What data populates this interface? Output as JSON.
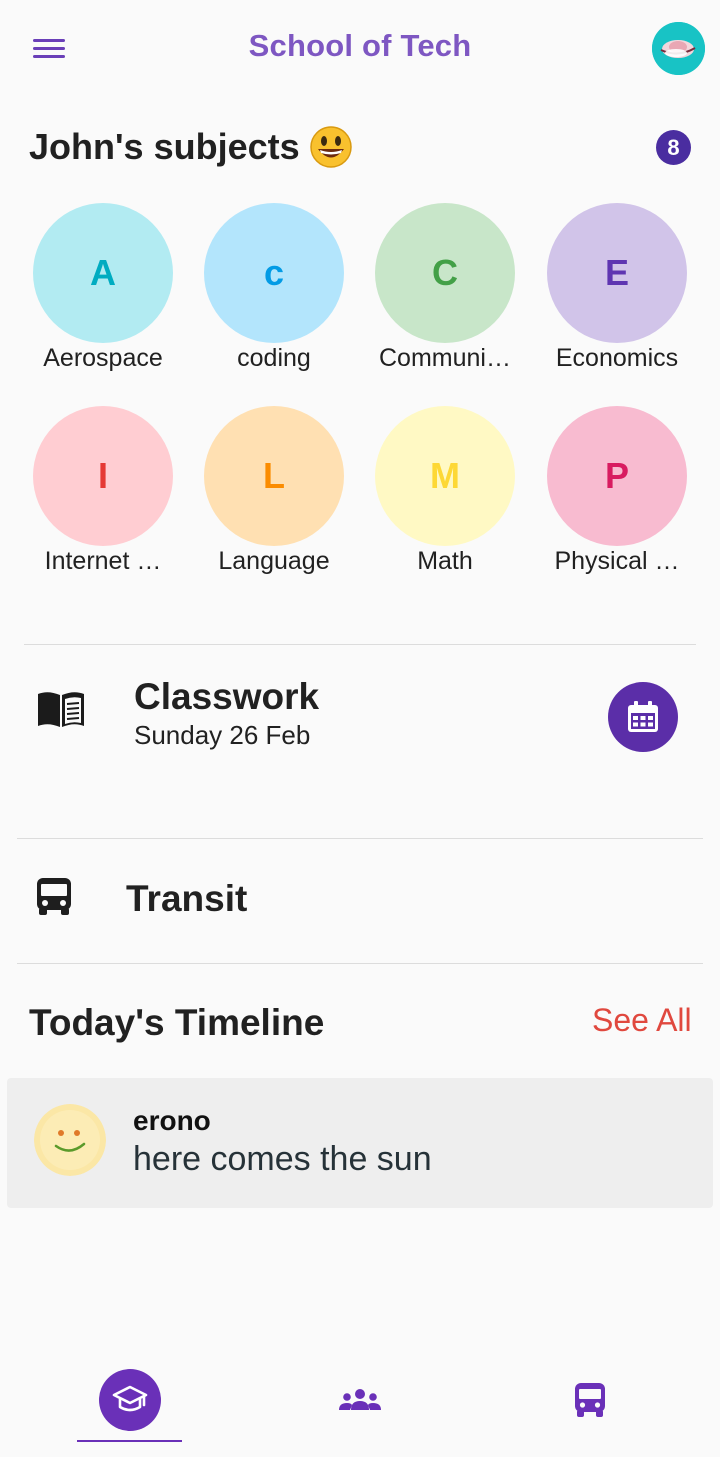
{
  "app_bar": {
    "title": "School of Tech",
    "menu_icon": "hamburger-menu-icon",
    "avatar_icon": "profile-avatar"
  },
  "subjects": {
    "heading": "John's subjects",
    "heading_emoji": "grinning-face",
    "count": "8",
    "items": [
      {
        "letter": "A",
        "label": "Aerospace",
        "bg": "#b2ebf2",
        "fg": "#00acc1"
      },
      {
        "letter": "c",
        "label": "coding",
        "bg": "#b3e5fc",
        "fg": "#039be5"
      },
      {
        "letter": "C",
        "label": "Communi…",
        "bg": "#c8e6c9",
        "fg": "#43a047"
      },
      {
        "letter": "E",
        "label": "Economics",
        "bg": "#d1c4e9",
        "fg": "#5e35b1"
      },
      {
        "letter": "I",
        "label": "Internet …",
        "bg": "#ffcdd2",
        "fg": "#e53935"
      },
      {
        "letter": "L",
        "label": "Language",
        "bg": "#ffe0b2",
        "fg": "#fb8c00"
      },
      {
        "letter": "M",
        "label": "Math",
        "bg": "#fff9c4",
        "fg": "#fdd835"
      },
      {
        "letter": "P",
        "label": "Physical …",
        "bg": "#f8bbd0",
        "fg": "#d81b60"
      }
    ]
  },
  "classwork": {
    "title": "Classwork",
    "date": "Sunday 26 Feb",
    "icon": "book-icon",
    "action_icon": "calendar-icon"
  },
  "transit": {
    "title": "Transit",
    "icon": "bus-icon"
  },
  "timeline": {
    "heading": "Today's Timeline",
    "see_all": "See All",
    "posts": [
      {
        "author": "erono",
        "text": "here comes the sun",
        "avatar": "sun-smiley-avatar"
      }
    ]
  },
  "bottom_nav": {
    "items": [
      {
        "icon": "graduation-cap-icon",
        "active": true
      },
      {
        "icon": "people-group-icon",
        "active": false
      },
      {
        "icon": "bus-icon",
        "active": false
      }
    ],
    "accent": "#6a30b8"
  }
}
